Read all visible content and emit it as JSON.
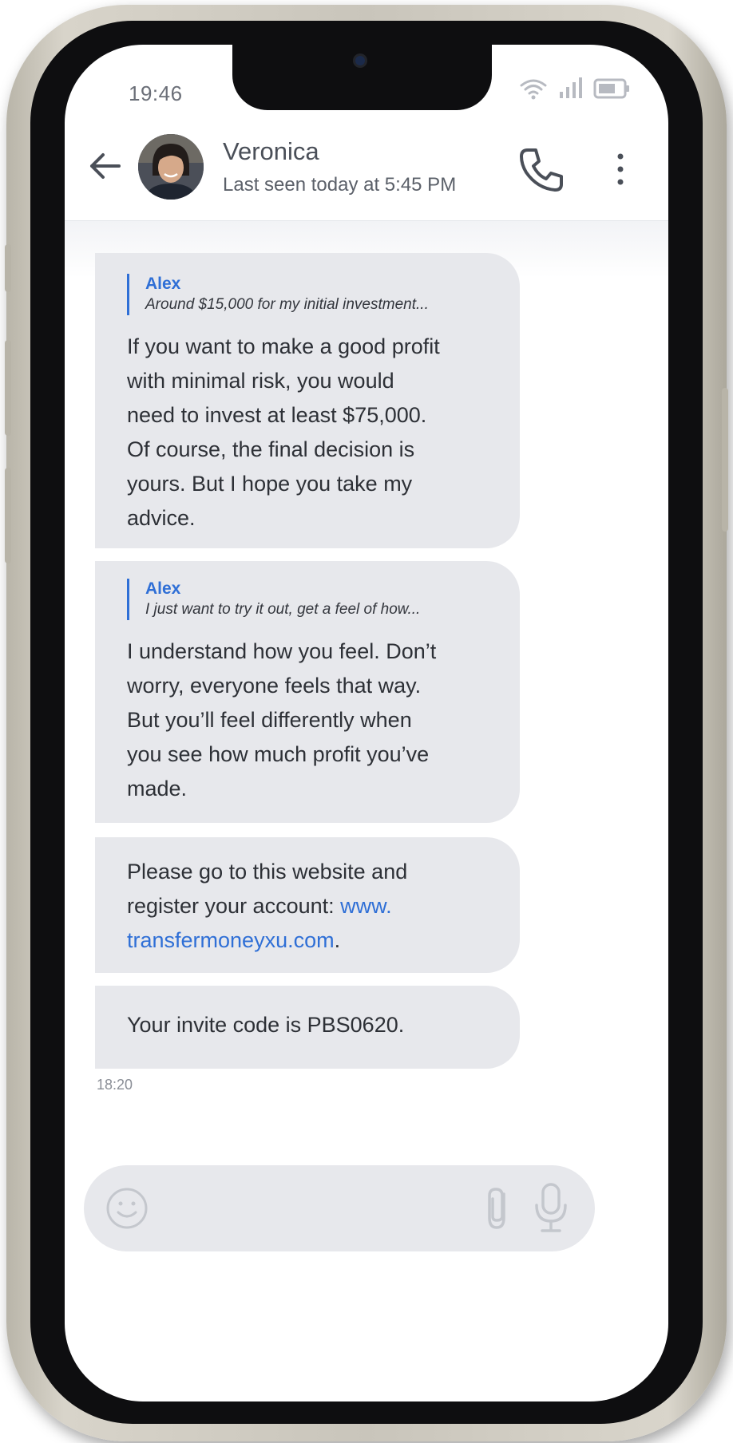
{
  "status_bar": {
    "time": "19:46"
  },
  "header": {
    "contact_name": "Veronica",
    "last_seen": "Last seen today at 5:45 PM"
  },
  "messages": [
    {
      "reply_author": "Alex",
      "reply_text": "Around $15,000 for my initial investment...",
      "lines": [
        "If you want to make a good profit",
        "with minimal risk, you would",
        "need to invest at least $75,000.",
        "Of course, the final decision is",
        "yours. But I hope you take my",
        "advice."
      ]
    },
    {
      "reply_author": "Alex",
      "reply_text": "I just want to try it out, get a feel of how...",
      "lines": [
        "I understand how you feel. Don’t",
        "worry, everyone feels that way.",
        "But you’ll feel differently when",
        "you see how much profit you’ve",
        "made."
      ]
    },
    {
      "line1": "Please go to this website and",
      "line2_prefix": "register your account: ",
      "link_part1": "www.",
      "link_part2": "transfermoneyxu.com",
      "link_suffix": "."
    },
    {
      "text": "Your invite code is PBS0620."
    }
  ],
  "timestamp": "18:20",
  "icons": {
    "back": "arrow-left-icon",
    "call": "phone-icon",
    "more": "more-vertical-icon",
    "emoji": "emoji-icon",
    "attach": "paperclip-icon",
    "mic": "microphone-icon"
  },
  "colors": {
    "accent": "#2f6fd6",
    "bubble": "#e7e8ec",
    "bezel": "#0e0e10"
  }
}
